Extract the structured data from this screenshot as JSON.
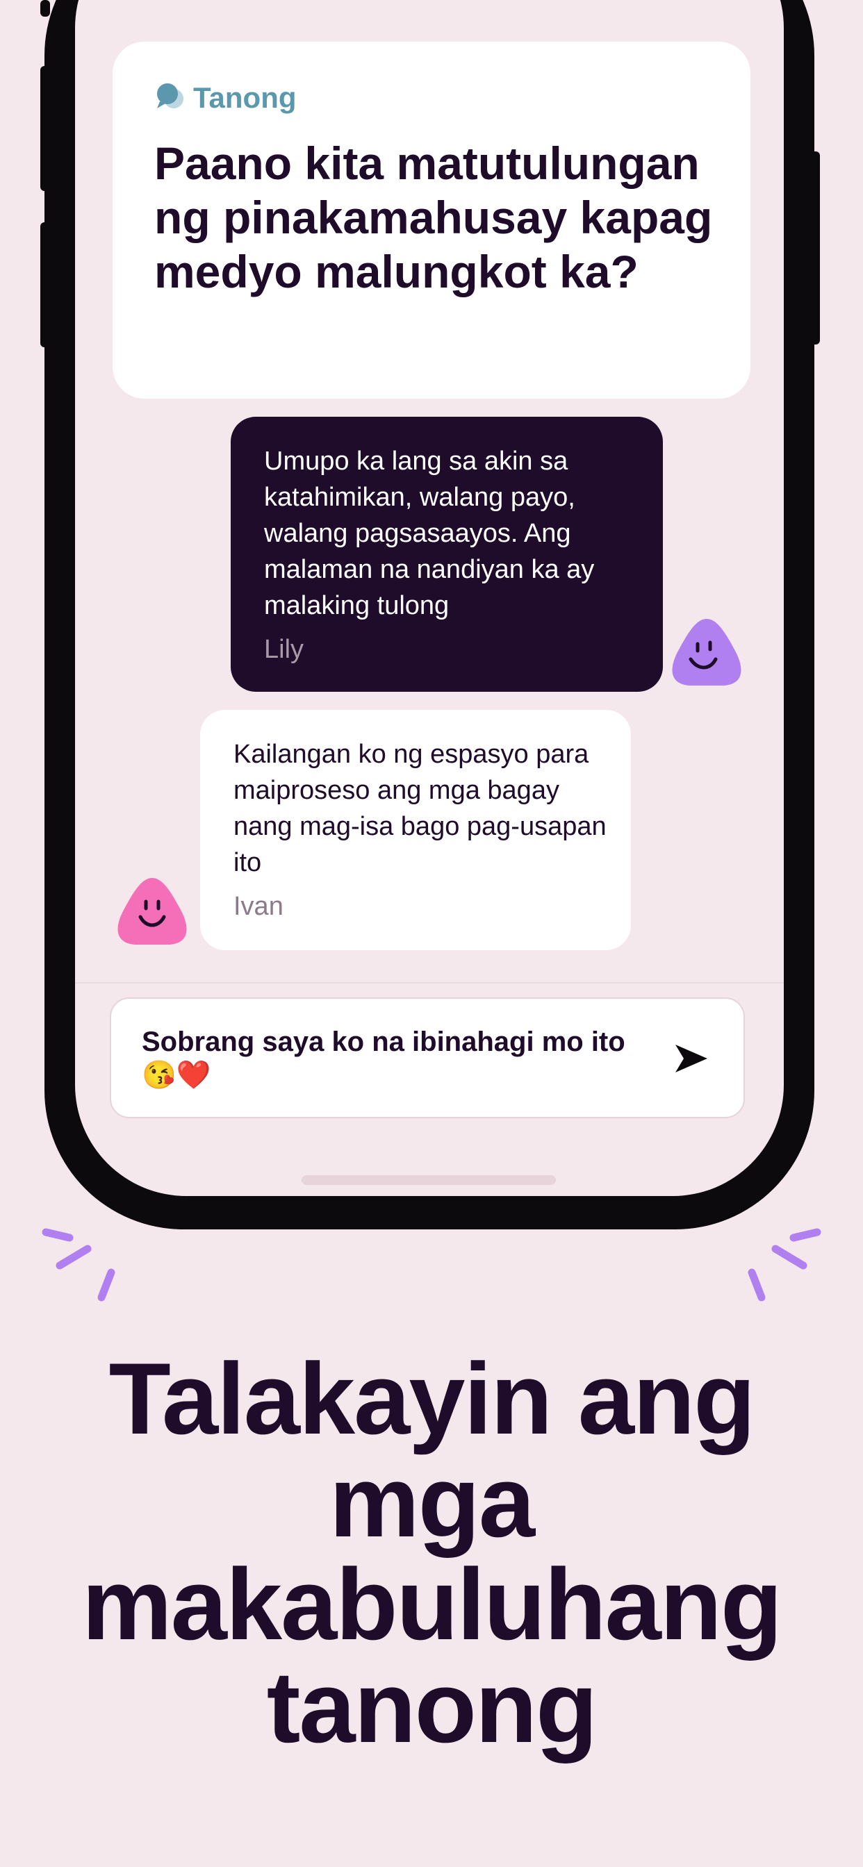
{
  "question_card": {
    "badge_icon": "chat-bubbles-icon",
    "badge_label": "Tanong",
    "question": "Paano kita matutulungan ng pinakamahusay kapag medyo malungkot ka?"
  },
  "messages": [
    {
      "text": "Umupo ka lang sa akin sa katahimikan, walang payo, walang pagsasaayos. Ang malaman na nandiyan ka ay malaking tulong",
      "author": "Lily",
      "avatar_icon": "purple-smiley-avatar-icon",
      "avatar_color": "#b07ff0"
    },
    {
      "text": "Kailangan ko ng espasyo para maiproseso ang mga bagay nang mag-isa bago pag-usapan ito",
      "author": "Ivan",
      "avatar_icon": "pink-smiley-avatar-icon",
      "avatar_color": "#f56fb8"
    }
  ],
  "composer": {
    "value": "Sobrang saya ko na ibinahagi mo ito😘❤️",
    "send_icon": "send-arrow-icon"
  },
  "headline": "Talakayin ang mga makabuluhang tanong",
  "colors": {
    "background": "#f5e8ec",
    "dark_text": "#1f0b2a",
    "accent_blue": "#5b97ad",
    "sparkle_purple": "#b07ff0"
  }
}
